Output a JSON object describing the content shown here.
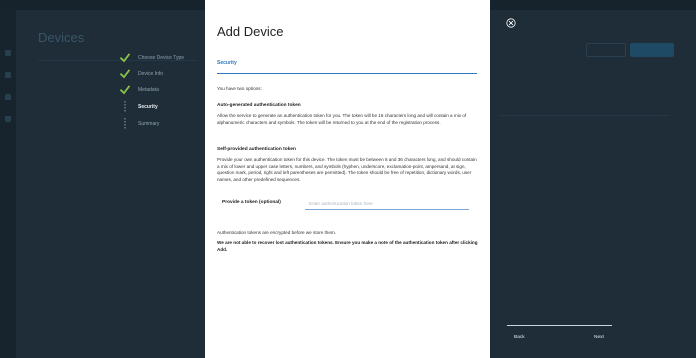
{
  "background": {
    "page_title": "Devices"
  },
  "stepper": {
    "steps": [
      {
        "label": "Choose Device Type",
        "state": "done"
      },
      {
        "label": "Device Info",
        "state": "done"
      },
      {
        "label": "Metadata",
        "state": "done"
      },
      {
        "label": "Security",
        "state": "active"
      },
      {
        "label": "Summary",
        "state": "pending"
      }
    ]
  },
  "modal": {
    "title": "Add Device",
    "tab_label": "Security",
    "intro": "You have two options:",
    "auto_heading": "Auto-generated authentication token",
    "auto_text": "Allow the service to generate an authentication token for you. The token will be 16 characters long and will contain a mix of alphanumeric characters and symbols. The token will be returned to you at the end of the registration process.",
    "self_heading": "Self-provided authentication token",
    "self_text": "Provide your own authentication token for this device. The token must be between 8 and 36 characters long, and should contain a mix of lower and upper case letters, numbers, and symbols (hyphen, underscore, exclamation-point, ampersand, at sign, question mark, period, right and left parentheses are permitted). The token should be free of repetition, dictionary words, user names, and other predefined sequences.",
    "token_label": "Provide a token (optional)",
    "token_placeholder": "Enter authentication token here",
    "token_value": "",
    "encrypted_note": "Authentication tokens are encrypted before we store them.",
    "warning": "We are not able to recover lost authentication tokens. Ensure you make a note of the authentication token after clicking Add."
  },
  "footer": {
    "back_label": "Back",
    "next_label": "Next"
  },
  "colors": {
    "accent": "#2c78c2",
    "check": "#8bc34a",
    "overlay": "#1e2d38"
  },
  "icons": {
    "close": "close-icon",
    "check": "checkmark-icon"
  }
}
